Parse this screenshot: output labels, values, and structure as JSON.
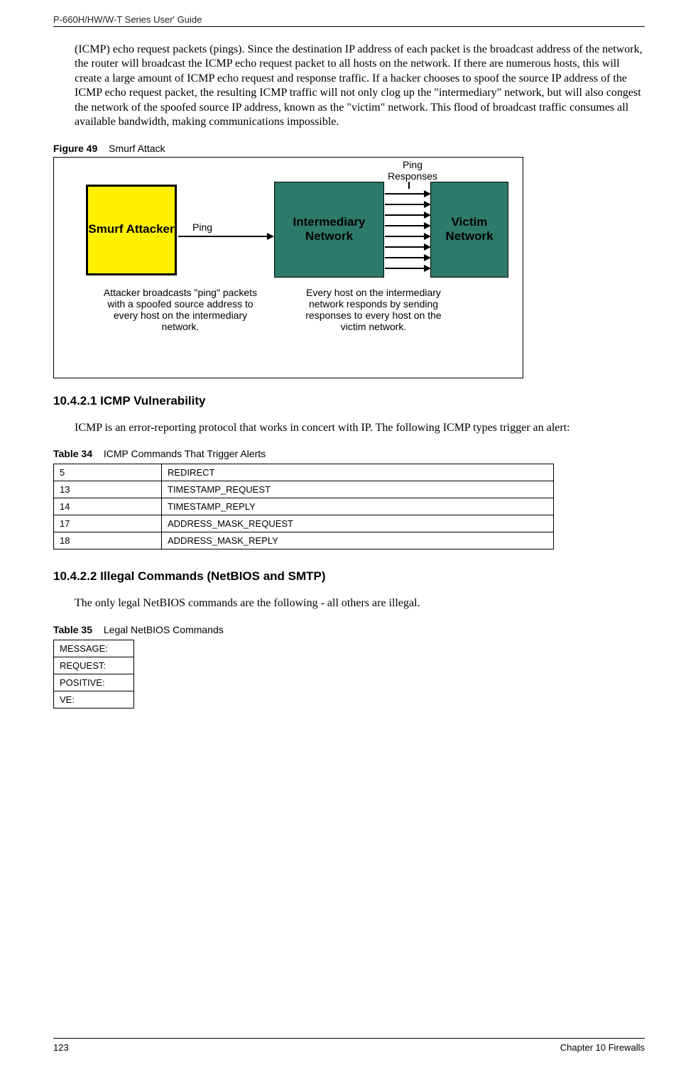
{
  "header": {
    "guide_title": "P-660H/HW/W-T Series User' Guide"
  },
  "paragraphs": {
    "intro": "(ICMP) echo request packets (pings). Since the destination IP address of each packet is the broadcast address of the network, the router will broadcast the ICMP echo request packet to all hosts on the network. If there are numerous hosts, this will create a large amount of ICMP echo request and response traffic. If a hacker chooses to spoof the source IP address of the ICMP echo request packet, the resulting ICMP traffic will not only clog up the \"intermediary\" network, but will also congest the network of the spoofed source IP address, known as the \"victim\" network. This flood of broadcast traffic consumes all available bandwidth, making communications impossible.",
    "icmp_intro": "ICMP is an error-reporting protocol that works in concert with IP. The following ICMP types trigger an alert:",
    "netbios_intro": "The only legal NetBIOS commands are the following - all others are illegal."
  },
  "figure": {
    "number_label": "Figure 49",
    "caption": "Smurf Attack",
    "smurf_label": "Smurf Attacker",
    "intermediary_label": "Intermediary Network",
    "victim_label": "Victim Network",
    "ping_label": "Ping",
    "ping_responses_label": "Ping Responses",
    "attacker_explain": "Attacker broadcasts \"ping\" packets with a spoofed source address to every host on the intermediary network.",
    "host_explain": "Every host on the intermediary network responds by sending responses to every host on the victim network."
  },
  "sections": {
    "icmp_heading": "10.4.2.1  ICMP Vulnerability",
    "netbios_heading": "10.4.2.2  Illegal Commands (NetBIOS and SMTP)"
  },
  "table34": {
    "number_label": "Table 34",
    "caption": "ICMP Commands That Trigger Alerts",
    "rows": [
      {
        "num": "5",
        "name": "REDIRECT"
      },
      {
        "num": "13",
        "name": "TIMESTAMP_REQUEST"
      },
      {
        "num": "14",
        "name": "TIMESTAMP_REPLY"
      },
      {
        "num": "17",
        "name": "ADDRESS_MASK_REQUEST"
      },
      {
        "num": "18",
        "name": "ADDRESS_MASK_REPLY"
      }
    ]
  },
  "table35": {
    "number_label": "Table 35",
    "caption": "Legal NetBIOS Commands",
    "rows": [
      "MESSAGE:",
      "REQUEST:",
      "POSITIVE:",
      "VE:"
    ]
  },
  "footer": {
    "page_number": "123",
    "chapter": "Chapter 10 Firewalls"
  }
}
